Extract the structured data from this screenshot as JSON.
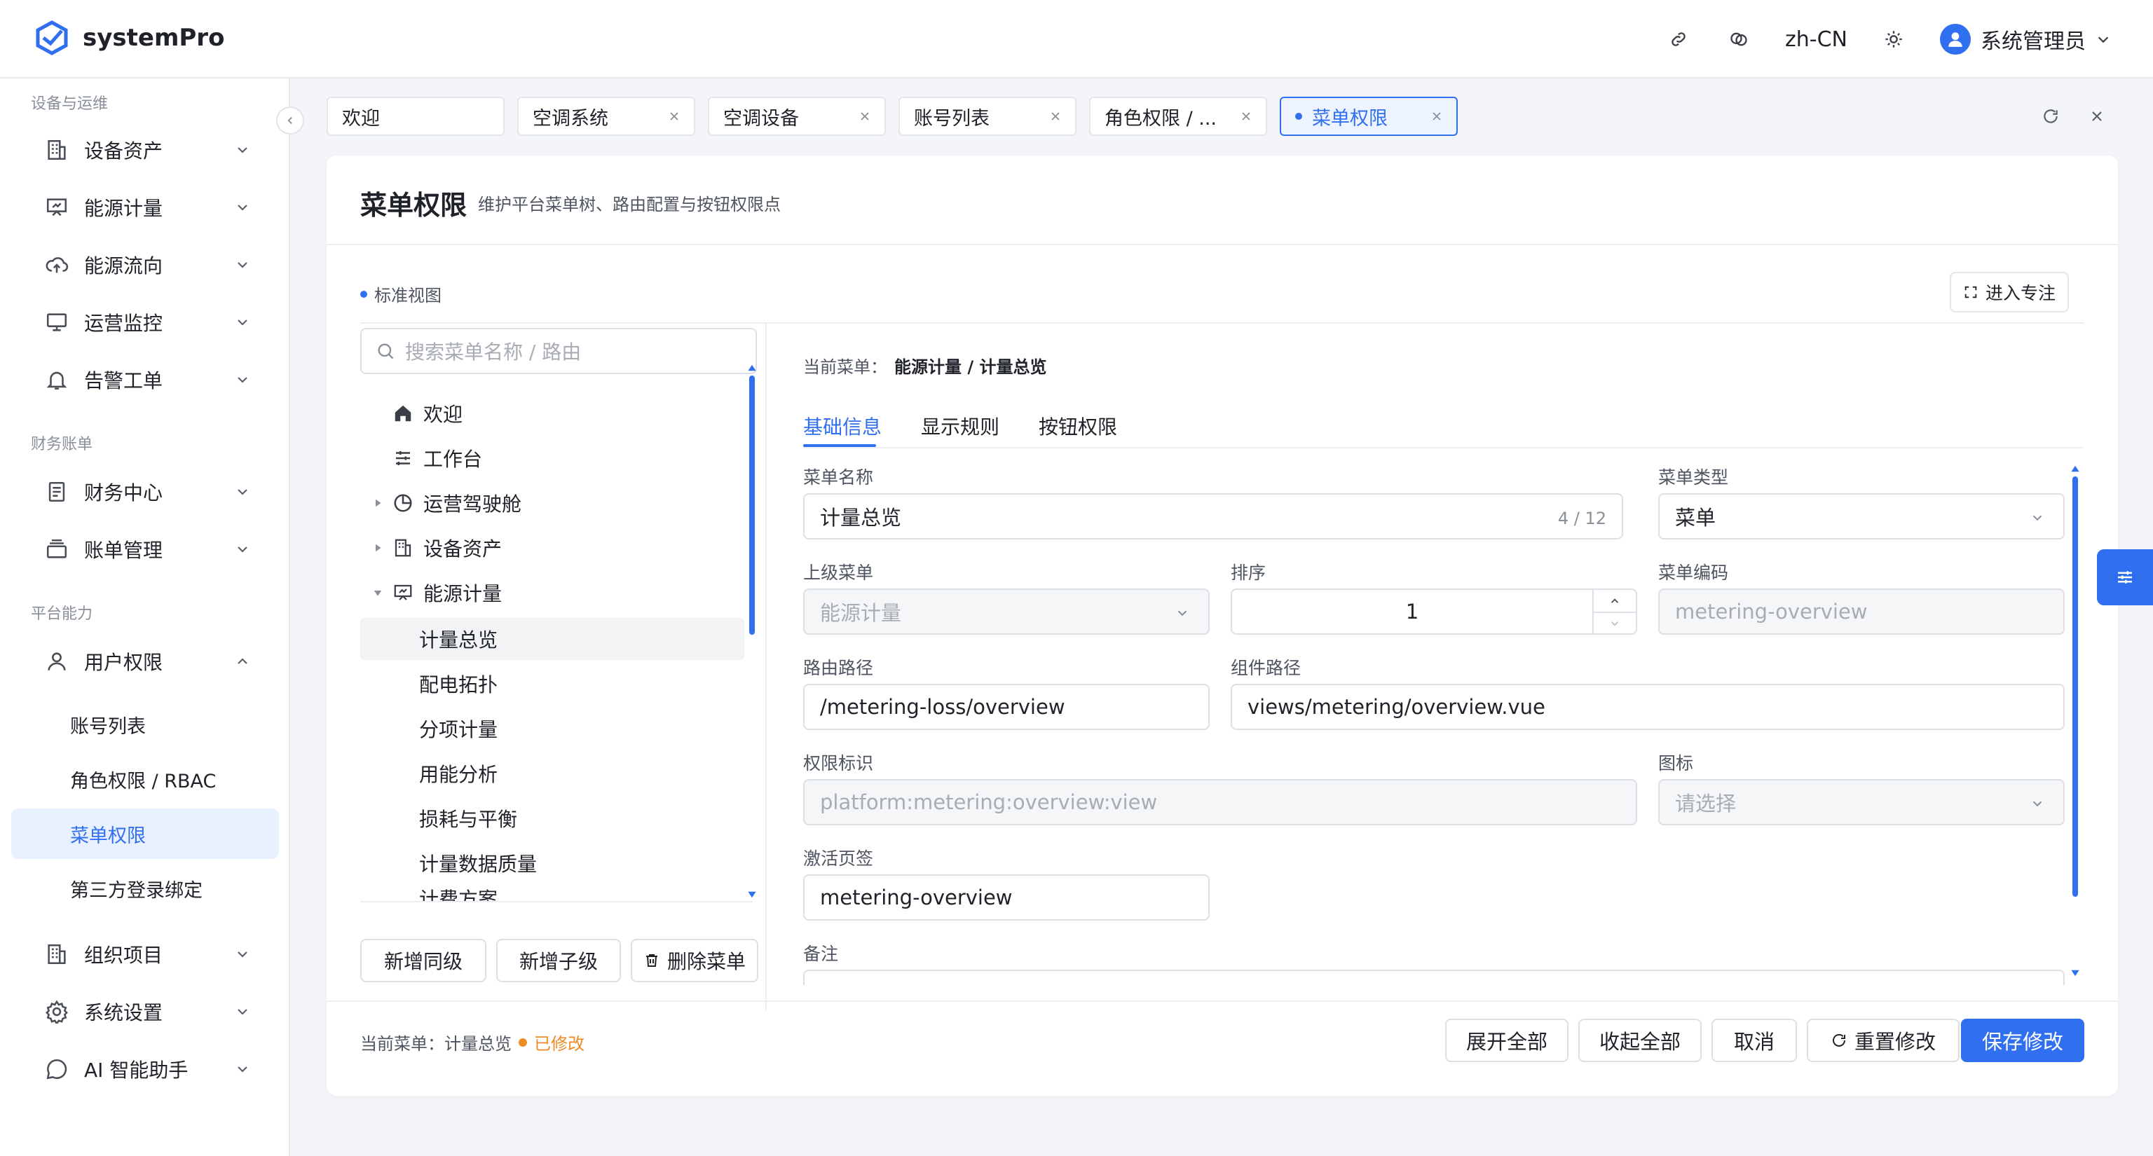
{
  "app": {
    "name": "systemPro"
  },
  "header": {
    "lang": "zh-CN",
    "user": "系统管理员"
  },
  "sidebar": {
    "groups": [
      {
        "title": "设备与运维",
        "items": [
          "设备资产",
          "能源计量",
          "能源流向",
          "运营监控",
          "告警工单"
        ]
      },
      {
        "title": "财务账单",
        "items": [
          "财务中心",
          "账单管理"
        ]
      },
      {
        "title": "平台能力",
        "items": [
          "用户权限",
          "组织项目",
          "系统设置",
          "AI 智能助手"
        ]
      }
    ],
    "user_perm_children": [
      "账号列表",
      "角色权限 / RBAC",
      "菜单权限",
      "第三方登录绑定"
    ]
  },
  "tabs": [
    "欢迎",
    "空调系统",
    "空调设备",
    "账号列表",
    "角色权限 / ...",
    "菜单权限"
  ],
  "page": {
    "title": "菜单权限",
    "desc": "维护平台菜单树、路由配置与按钮权限点",
    "view_mode": "标准视图",
    "focus_btn": "进入专注"
  },
  "tree": {
    "search_placeholder": "搜索菜单名称 / 路由",
    "items": [
      "欢迎",
      "工作台",
      "运营驾驶舱",
      "设备资产",
      "能源计量",
      "计量总览",
      "配电拓扑",
      "分项计量",
      "用能分析",
      "损耗与平衡",
      "计量数据质量",
      "计费方案"
    ],
    "buttons": [
      "新增同级",
      "新增子级",
      "删除菜单"
    ]
  },
  "form": {
    "current_label": "当前菜单：",
    "current_value": "能源计量 / 计量总览",
    "tabs": [
      "基础信息",
      "显示规则",
      "按钮权限"
    ],
    "labels": {
      "name": "菜单名称",
      "type": "菜单类型",
      "parent": "上级菜单",
      "order": "排序",
      "code": "菜单编码",
      "route": "路由路径",
      "component": "组件路径",
      "perm": "权限标识",
      "icon": "图标",
      "active_tab": "激活页签",
      "remark": "备注"
    },
    "values": {
      "name": "计量总览",
      "name_count": "4 / 12",
      "type": "菜单",
      "parent": "能源计量",
      "order": "1",
      "code": "metering-overview",
      "route": "/metering-loss/overview",
      "component": "views/metering/overview.vue",
      "perm": "platform:metering:overview:view",
      "icon_placeholder": "请选择",
      "active_tab": "metering-overview"
    }
  },
  "footer": {
    "status_label": "当前菜单：计量总览",
    "modified": "已修改",
    "buttons": [
      "展开全部",
      "收起全部",
      "取消",
      "重置修改",
      "保存修改"
    ]
  },
  "colors": {
    "accent": "#2f6ff0",
    "modified": "#f08a24"
  }
}
